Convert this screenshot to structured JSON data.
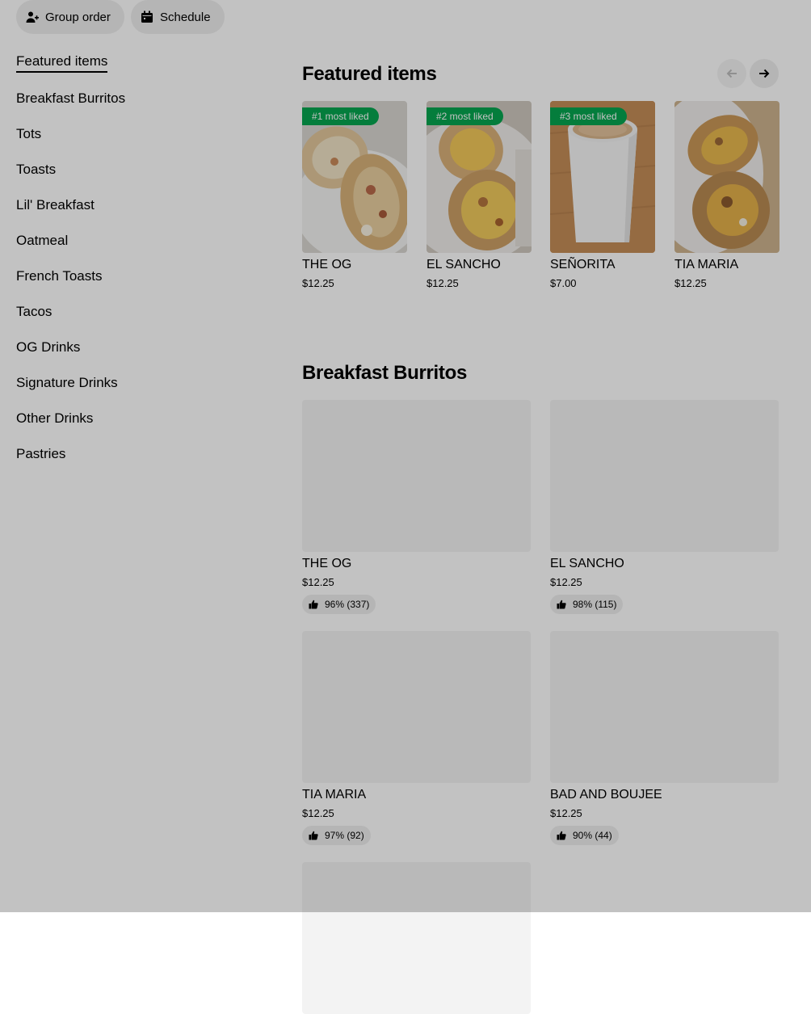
{
  "top_actions": {
    "group_order": "Group order",
    "schedule": "Schedule"
  },
  "sidebar": {
    "items": [
      {
        "label": "Featured items",
        "active": true
      },
      {
        "label": "Breakfast Burritos"
      },
      {
        "label": "Tots"
      },
      {
        "label": "Toasts"
      },
      {
        "label": "Lil' Breakfast"
      },
      {
        "label": "Oatmeal"
      },
      {
        "label": "French Toasts"
      },
      {
        "label": "Tacos"
      },
      {
        "label": "OG Drinks"
      },
      {
        "label": "Signature Drinks"
      },
      {
        "label": "Other Drinks"
      },
      {
        "label": "Pastries"
      }
    ]
  },
  "featured": {
    "title": "Featured items",
    "items": [
      {
        "badge": "#1 most liked",
        "name": "THE OG",
        "price": "$12.25",
        "image": "burrito"
      },
      {
        "badge": "#2 most liked",
        "name": "EL SANCHO",
        "price": "$12.25",
        "image": "burrito"
      },
      {
        "badge": "#3 most liked",
        "name": "SEÑORITA",
        "price": "$7.00",
        "image": "coffee-cup"
      },
      {
        "name": "TIA MARIA",
        "price": "$12.25",
        "image": "burrito"
      }
    ]
  },
  "breakfast_burritos": {
    "title": "Breakfast Burritos",
    "items": [
      {
        "name": "THE OG",
        "price": "$12.25",
        "rating": "96% (337)"
      },
      {
        "name": "EL SANCHO",
        "price": "$12.25",
        "rating": "98% (115)"
      },
      {
        "name": "TIA MARIA",
        "price": "$12.25",
        "rating": "97% (92)"
      },
      {
        "name": "BAD AND BOUJEE",
        "price": "$12.25",
        "rating": "90% (44)"
      }
    ]
  },
  "colors": {
    "badge_green": "#06a54f",
    "overlay": "rgba(0,0,0,0.24)"
  }
}
